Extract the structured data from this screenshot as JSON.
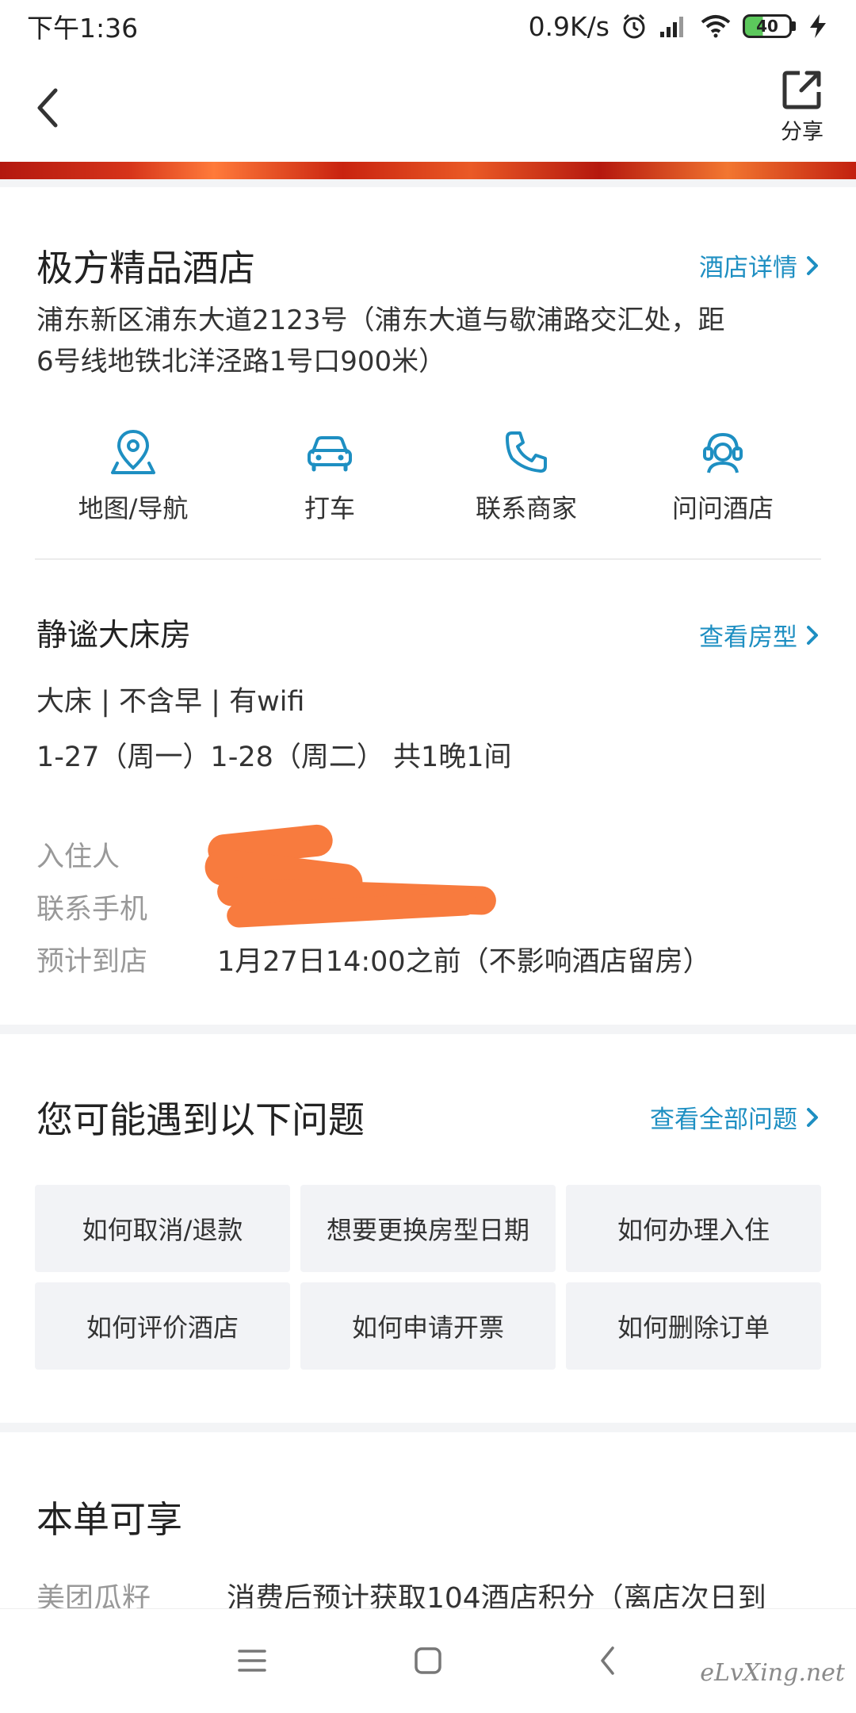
{
  "status_bar": {
    "time": "下午1:36",
    "network_speed": "0.9K/s",
    "battery": "40"
  },
  "nav": {
    "share_label": "分享"
  },
  "hotel": {
    "name": "极方精品酒店",
    "detail_link": "酒店详情",
    "address_line1": "浦东新区浦东大道2123号（浦东大道与歇浦路交汇处，距",
    "address_line2": "6号线地铁北洋泾路1号口900米）",
    "actions": [
      {
        "label": "地图/导航",
        "icon": "map-pin-icon"
      },
      {
        "label": "打车",
        "icon": "car-icon"
      },
      {
        "label": "联系商家",
        "icon": "phone-icon"
      },
      {
        "label": "问问酒店",
        "icon": "customer-service-icon"
      }
    ]
  },
  "room": {
    "name": "静谧大床房",
    "view_link": "查看房型",
    "tags": "大床 | 不含早 | 有wifi",
    "dates": "1-27（周一）1-28（周二） 共1晚1间",
    "guest_label": "入住人",
    "phone_label": "联系手机",
    "arrival_label": "预计到店",
    "arrival_value": "1月27日14:00之前（不影响酒店留房）"
  },
  "problems": {
    "title": "您可能遇到以下问题",
    "view_all": "查看全部问题",
    "items": [
      "如何取消/退款",
      "想要更换房型日期",
      "如何办理入住",
      "如何评价酒店",
      "如何申请开票",
      "如何删除订单"
    ]
  },
  "benefits": {
    "title": "本单可享",
    "label": "美团瓜籽",
    "text": "消费后预计获取104酒店积分（离店次日到"
  },
  "watermark": "eLvXing.net",
  "colors": {
    "accent": "#1e8fc2",
    "redaction": "#f87b3e"
  }
}
